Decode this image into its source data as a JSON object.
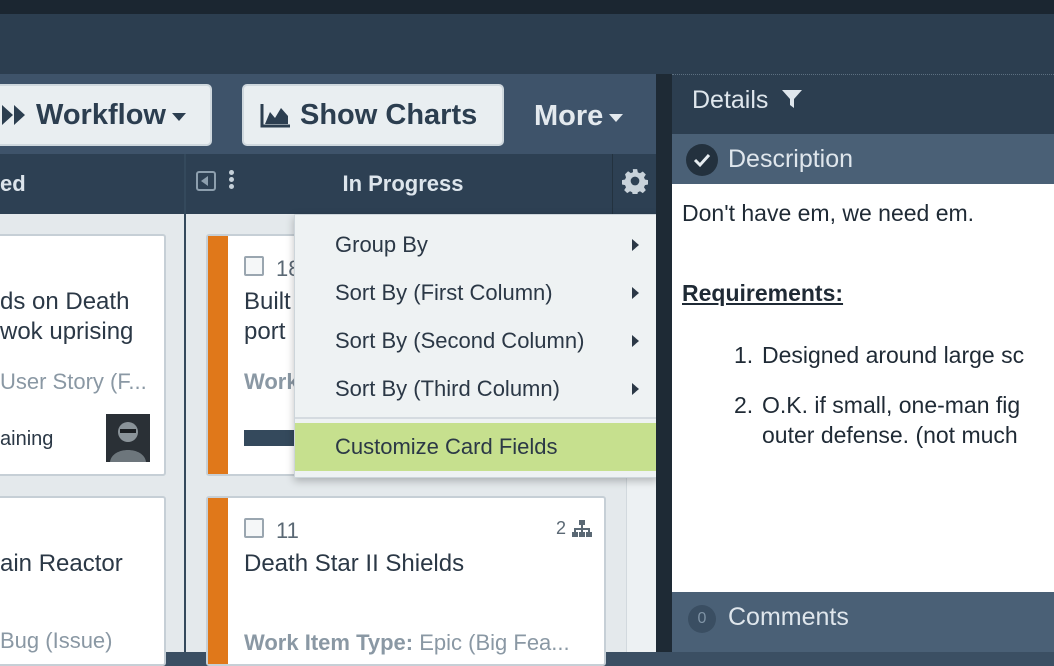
{
  "toolbar": {
    "workflow_label": "Workflow",
    "charts_label": "Show Charts",
    "more_label": "More"
  },
  "columns": {
    "left_title_fragment": "ed",
    "in_progress_title": "In Progress"
  },
  "cards": {
    "a": {
      "title_line1": "ds on Death",
      "title_line2": "wok uprising",
      "type": "User Story (F...",
      "status": "aining"
    },
    "b": {
      "title": "ain Reactor",
      "type": "Bug (Issue)"
    },
    "c": {
      "id": "18",
      "title_line1": "Built",
      "title_line2": "port",
      "type_label": "Work"
    },
    "d": {
      "id": "11",
      "title": "Death Star II Shields",
      "children_count": "2",
      "type_label": "Work Item Type:",
      "type_value": "Epic (Big Fea..."
    }
  },
  "menu": {
    "items": [
      {
        "label": "Group By"
      },
      {
        "label": "Sort By (First Column)"
      },
      {
        "label": "Sort By (Second Column)"
      },
      {
        "label": "Sort By (Third Column)"
      }
    ],
    "customize_label": "Customize Card Fields"
  },
  "details": {
    "title": "Details",
    "description_title": "Description",
    "body_line1": "Don't have em, we need em.",
    "requirements_heading": "Requirements:",
    "req1_num": "1.",
    "req1": "Designed around large sc",
    "req2_num": "2.",
    "req2_line1": "O.K. if small, one-man fig",
    "req2_line2": "outer defense.  (not much",
    "comments_title": "Comments",
    "comments_count": "0"
  },
  "colors": {
    "accent_orange": "#e0781a",
    "highlight_green": "#c6e08e",
    "header_dark": "#2c3e50"
  }
}
